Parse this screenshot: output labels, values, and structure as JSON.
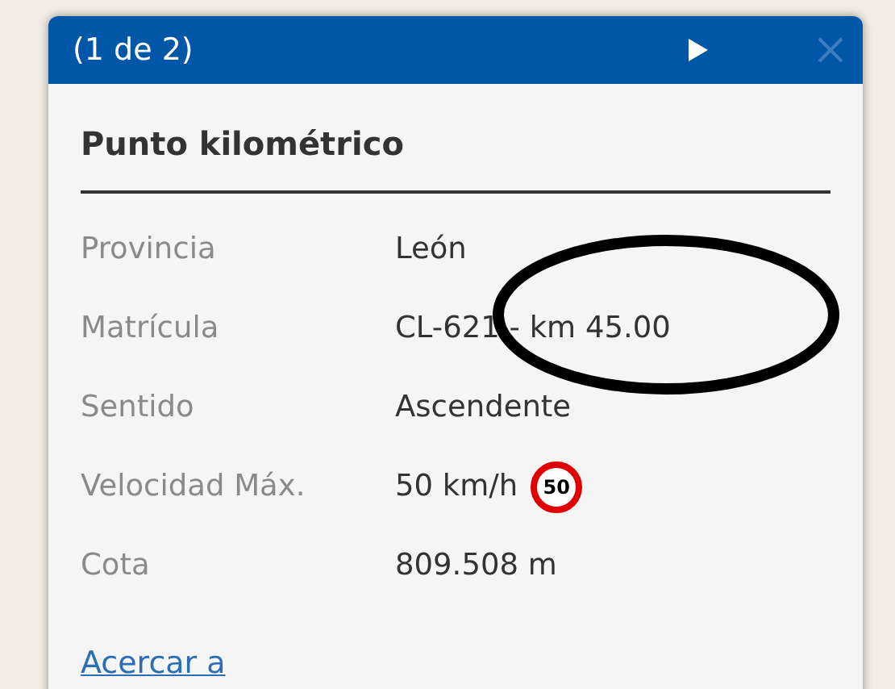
{
  "popup": {
    "title": "(1 de 2)",
    "heading": "Punto kilométrico",
    "rows": [
      {
        "label": "Provincia",
        "value": "León"
      },
      {
        "label": "Matrícula",
        "value": "CL-621 - km 45.00"
      },
      {
        "label": "Sentido",
        "value": "Ascendente"
      },
      {
        "label": "Velocidad Máx.",
        "value": "50 km/h",
        "sign": "50"
      },
      {
        "label": "Cota",
        "value": "809.508 m"
      }
    ],
    "link": "Acercar a"
  }
}
